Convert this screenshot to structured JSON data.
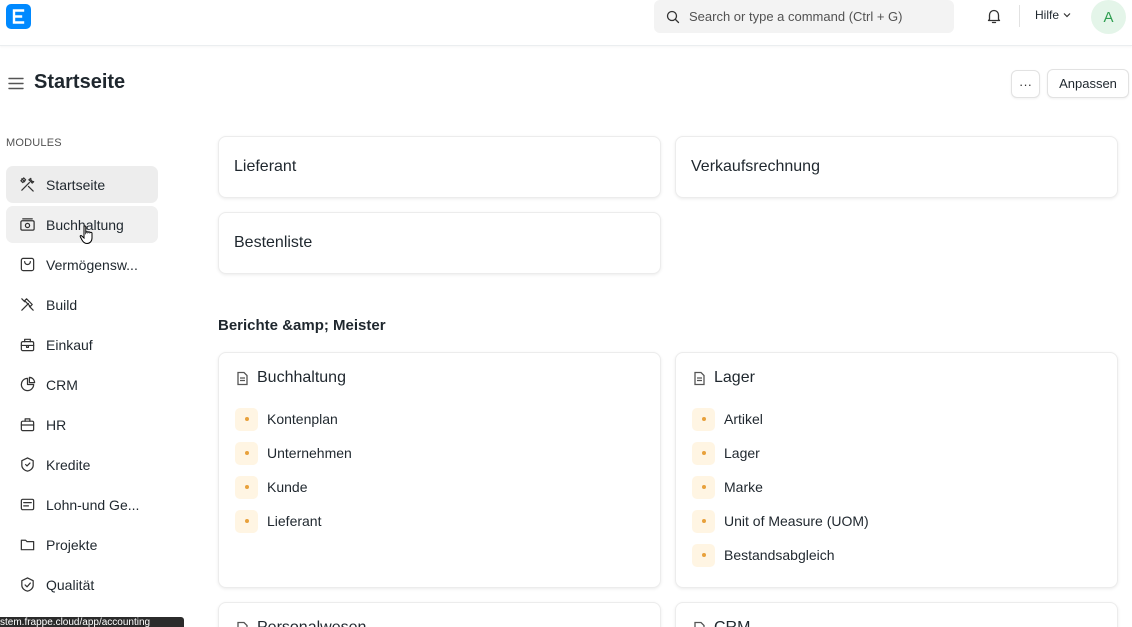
{
  "navbar": {
    "logo_letter": "E",
    "search_placeholder": "Search or type a command (Ctrl + G)",
    "help_label": "Hilfe",
    "avatar_initial": "A"
  },
  "page": {
    "title": "Startseite",
    "more_label": "···",
    "customize_label": "Anpassen"
  },
  "sidebar": {
    "section_label": "MODULES",
    "items": [
      {
        "label": "Startseite",
        "icon": "tools-icon"
      },
      {
        "label": "Buchhaltung",
        "icon": "accounting-icon"
      },
      {
        "label": "Vermögensw...",
        "icon": "asset-icon"
      },
      {
        "label": "Build",
        "icon": "hammer-icon"
      },
      {
        "label": "Einkauf",
        "icon": "purchase-icon"
      },
      {
        "label": "CRM",
        "icon": "crm-icon"
      },
      {
        "label": "HR",
        "icon": "hr-icon"
      },
      {
        "label": "Kredite",
        "icon": "loan-icon"
      },
      {
        "label": "Lohn-und Ge...",
        "icon": "payroll-icon"
      },
      {
        "label": "Projekte",
        "icon": "folder-icon"
      },
      {
        "label": "Qualität",
        "icon": "quality-icon"
      }
    ]
  },
  "shortcuts": [
    "Lieferant",
    "Verkaufsrechnung",
    "Bestenliste"
  ],
  "reports": {
    "section_title": "Berichte &amp; Meister",
    "cards": [
      {
        "title": "Buchhaltung",
        "links": [
          "Kontenplan",
          "Unternehmen",
          "Kunde",
          "Lieferant"
        ]
      },
      {
        "title": "Lager",
        "links": [
          "Artikel",
          "Lager",
          "Marke",
          "Unit of Measure (UOM)",
          "Bestandsabgleich"
        ]
      },
      {
        "title": "Personalwesen",
        "links": []
      },
      {
        "title": "CRM",
        "links": []
      }
    ]
  },
  "statusbar": {
    "url": "stem.frappe.cloud/app/accounting"
  },
  "colors": {
    "brand": "#0089ff",
    "avatar_bg": "#e4f5e9",
    "avatar_fg": "#2f9e51",
    "dot": "#e8a13b"
  }
}
